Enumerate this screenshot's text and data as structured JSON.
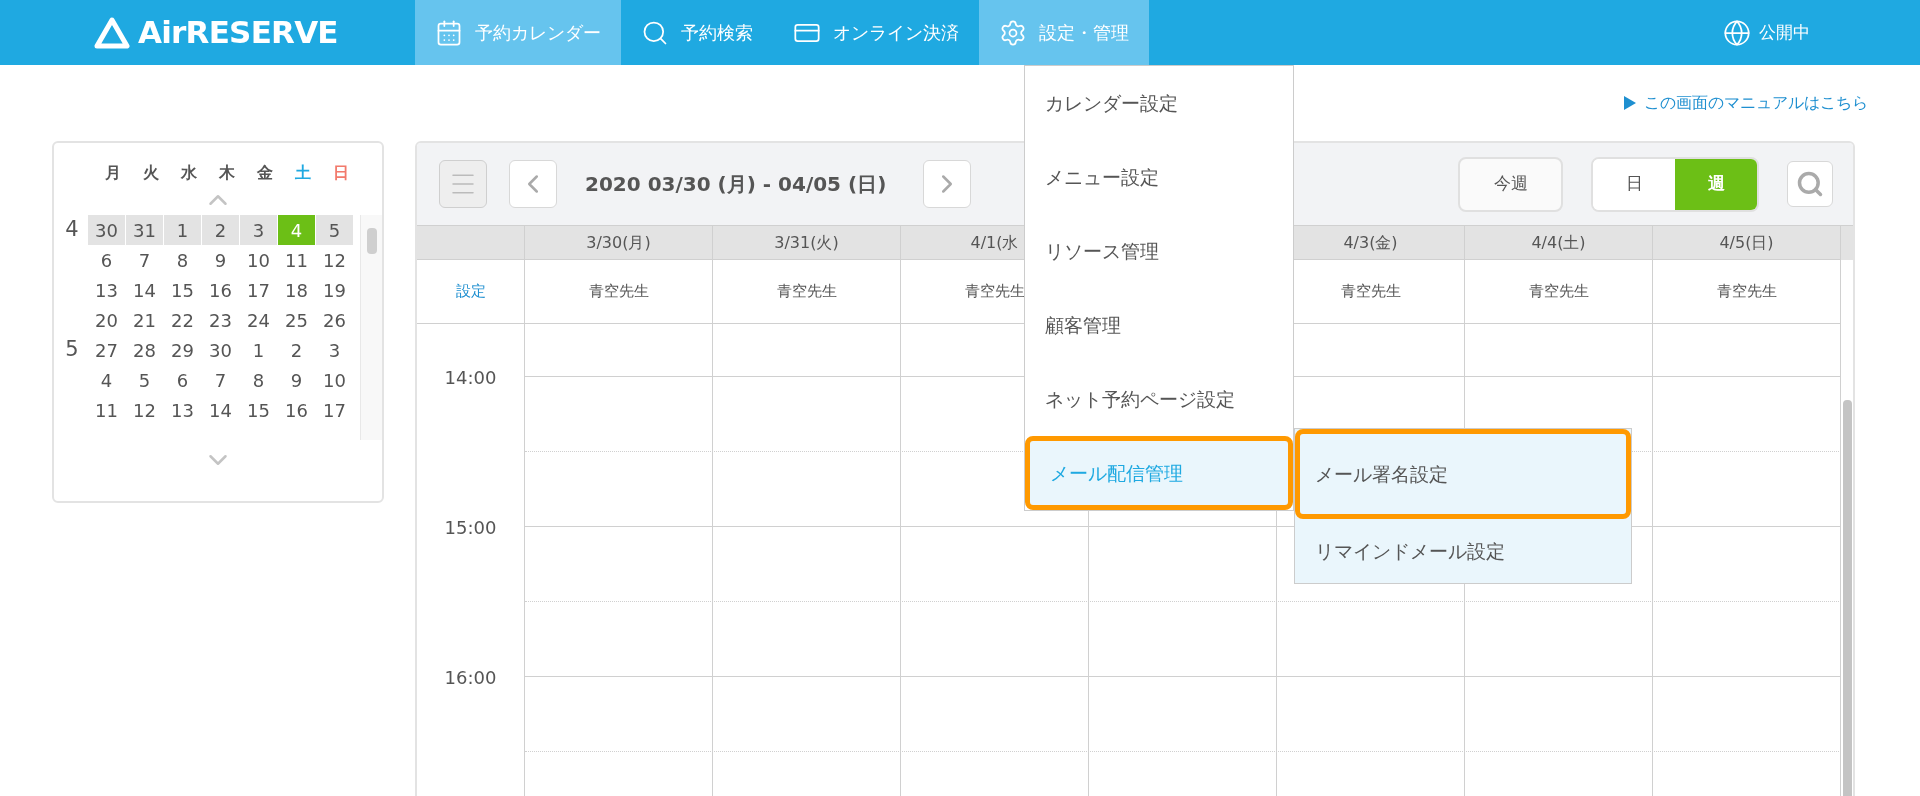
{
  "header": {
    "logo": "AirRESERVE",
    "nav": [
      {
        "label": "予約カレンダー",
        "selected": true
      },
      {
        "label": "予約検索",
        "selected": false
      },
      {
        "label": "オンライン決済",
        "selected": false
      },
      {
        "label": "設定・管理",
        "selected": true
      }
    ],
    "status": "公開中"
  },
  "manual_link": "この画面のマニュアルはこちら",
  "mini_calendar": {
    "weekdays": [
      {
        "label": "月",
        "kind": "weekday"
      },
      {
        "label": "火",
        "kind": "weekday"
      },
      {
        "label": "水",
        "kind": "weekday"
      },
      {
        "label": "木",
        "kind": "weekday"
      },
      {
        "label": "金",
        "kind": "weekday"
      },
      {
        "label": "土",
        "kind": "saturday"
      },
      {
        "label": "日",
        "kind": "sunday"
      }
    ],
    "weeks": [
      {
        "month": "4",
        "current": true,
        "days": [
          {
            "label": "30",
            "selected": false
          },
          {
            "label": "31",
            "selected": false
          },
          {
            "label": "1",
            "selected": false
          },
          {
            "label": "2",
            "selected": false
          },
          {
            "label": "3",
            "selected": false
          },
          {
            "label": "4",
            "selected": true
          },
          {
            "label": "5",
            "selected": false
          }
        ]
      },
      {
        "current": false,
        "days": [
          {
            "label": "6",
            "selected": false
          },
          {
            "label": "7",
            "selected": false
          },
          {
            "label": "8",
            "selected": false
          },
          {
            "label": "9",
            "selected": false
          },
          {
            "label": "10",
            "selected": false
          },
          {
            "label": "11",
            "selected": false
          },
          {
            "label": "12",
            "selected": false
          }
        ]
      },
      {
        "current": false,
        "days": [
          {
            "label": "13",
            "selected": false
          },
          {
            "label": "14",
            "selected": false
          },
          {
            "label": "15",
            "selected": false
          },
          {
            "label": "16",
            "selected": false
          },
          {
            "label": "17",
            "selected": false
          },
          {
            "label": "18",
            "selected": false
          },
          {
            "label": "19",
            "selected": false
          }
        ]
      },
      {
        "current": false,
        "days": [
          {
            "label": "20",
            "selected": false
          },
          {
            "label": "21",
            "selected": false
          },
          {
            "label": "22",
            "selected": false
          },
          {
            "label": "23",
            "selected": false
          },
          {
            "label": "24",
            "selected": false
          },
          {
            "label": "25",
            "selected": false
          },
          {
            "label": "26",
            "selected": false
          }
        ]
      },
      {
        "month": "5",
        "current": false,
        "days": [
          {
            "label": "27",
            "selected": false
          },
          {
            "label": "28",
            "selected": false
          },
          {
            "label": "29",
            "selected": false
          },
          {
            "label": "30",
            "selected": false
          },
          {
            "label": "1",
            "selected": false
          },
          {
            "label": "2",
            "selected": false
          },
          {
            "label": "3",
            "selected": false
          }
        ]
      },
      {
        "current": false,
        "days": [
          {
            "label": "4",
            "selected": false
          },
          {
            "label": "5",
            "selected": false
          },
          {
            "label": "6",
            "selected": false
          },
          {
            "label": "7",
            "selected": false
          },
          {
            "label": "8",
            "selected": false
          },
          {
            "label": "9",
            "selected": false
          },
          {
            "label": "10",
            "selected": false
          }
        ]
      },
      {
        "current": false,
        "days": [
          {
            "label": "11",
            "selected": false
          },
          {
            "label": "12",
            "selected": false
          },
          {
            "label": "13",
            "selected": false
          },
          {
            "label": "14",
            "selected": false
          },
          {
            "label": "15",
            "selected": false
          },
          {
            "label": "16",
            "selected": false
          },
          {
            "label": "17",
            "selected": false
          }
        ]
      }
    ]
  },
  "calendar": {
    "date_range": "2020 03/30 (月) - 04/05 (日)",
    "today_button": "今週",
    "views": [
      {
        "label": "日",
        "selected": false
      },
      {
        "label": "週",
        "selected": true
      }
    ],
    "settings_link": "設定",
    "columns": [
      {
        "date": "3/30(月)",
        "resource": "青空先生"
      },
      {
        "date": "3/31(火)",
        "resource": "青空先生"
      },
      {
        "date": "4/1(水",
        "resource": "青空先生"
      },
      {},
      {
        "date": "4/3(金)",
        "resource": "青空先生"
      },
      {
        "date": "4/4(土)",
        "resource": "青空先生"
      },
      {
        "date": "4/5(日)",
        "resource": "青空先生"
      }
    ],
    "times": [
      "14:00",
      "15:00",
      "16:00"
    ]
  },
  "settings_menu": {
    "items": [
      {
        "label": "カレンダー設定",
        "selected": false
      },
      {
        "label": "メニュー設定",
        "selected": false
      },
      {
        "label": "リソース管理",
        "selected": false
      },
      {
        "label": "顧客管理",
        "selected": false
      },
      {
        "label": "ネット予約ページ設定",
        "selected": false
      },
      {
        "label": "メール配信管理",
        "selected": true
      }
    ],
    "submenu": [
      {
        "label": "メール署名設定",
        "selected": true
      },
      {
        "label": "リマインドメール設定",
        "selected": false
      }
    ]
  }
}
